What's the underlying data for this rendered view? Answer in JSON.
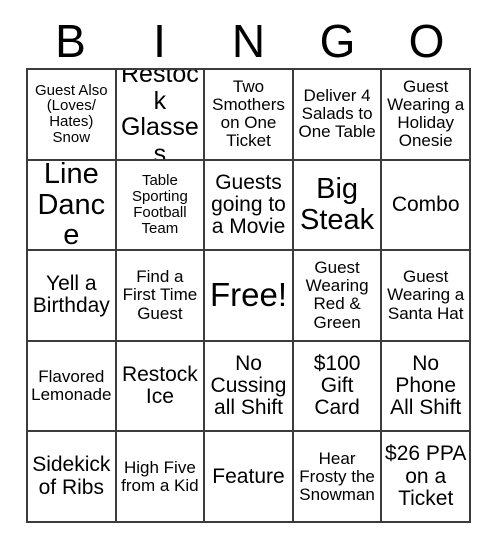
{
  "card": {
    "header_letters": [
      "B",
      "I",
      "N",
      "G",
      "O"
    ],
    "rows": [
      [
        {
          "text": "Guest Also (Loves/ Hates) Snow",
          "size": "xs"
        },
        {
          "text": "Restock Glasses",
          "size": "lg"
        },
        {
          "text": "Two Smothers on One Ticket",
          "size": "sm"
        },
        {
          "text": "Deliver 4 Salads to One Table",
          "size": "sm"
        },
        {
          "text": "Guest Wearing a Holiday Onesie",
          "size": "sm"
        }
      ],
      [
        {
          "text": "Line Dance",
          "size": "xl"
        },
        {
          "text": "Table Sporting Football Team",
          "size": "xs"
        },
        {
          "text": "Guests going to a Movie",
          "size": "md"
        },
        {
          "text": "Big Steak",
          "size": "xl"
        },
        {
          "text": "Combo",
          "size": "md"
        }
      ],
      [
        {
          "text": "Yell a Birthday",
          "size": "md"
        },
        {
          "text": "Find a First Time Guest",
          "size": "sm"
        },
        {
          "text": "Free!",
          "size": "free"
        },
        {
          "text": "Guest Wearing Red & Green",
          "size": "sm"
        },
        {
          "text": "Guest Wearing a Santa Hat",
          "size": "sm"
        }
      ],
      [
        {
          "text": "Flavored Lemonade",
          "size": "sm"
        },
        {
          "text": "Restock Ice",
          "size": "md"
        },
        {
          "text": "No Cussing all Shift",
          "size": "md"
        },
        {
          "text": "$100 Gift Card",
          "size": "md"
        },
        {
          "text": "No Phone All Shift",
          "size": "md"
        }
      ],
      [
        {
          "text": "Sidekick of Ribs",
          "size": "md"
        },
        {
          "text": "High Five from a Kid",
          "size": "sm"
        },
        {
          "text": "Feature",
          "size": "md"
        },
        {
          "text": "Hear Frosty the Snowman",
          "size": "sm"
        },
        {
          "text": "$26 PPA on a Ticket",
          "size": "md"
        }
      ]
    ]
  },
  "colors": {
    "grid_line": "#3c3c3c",
    "text": "#000000",
    "background": "#ffffff"
  }
}
